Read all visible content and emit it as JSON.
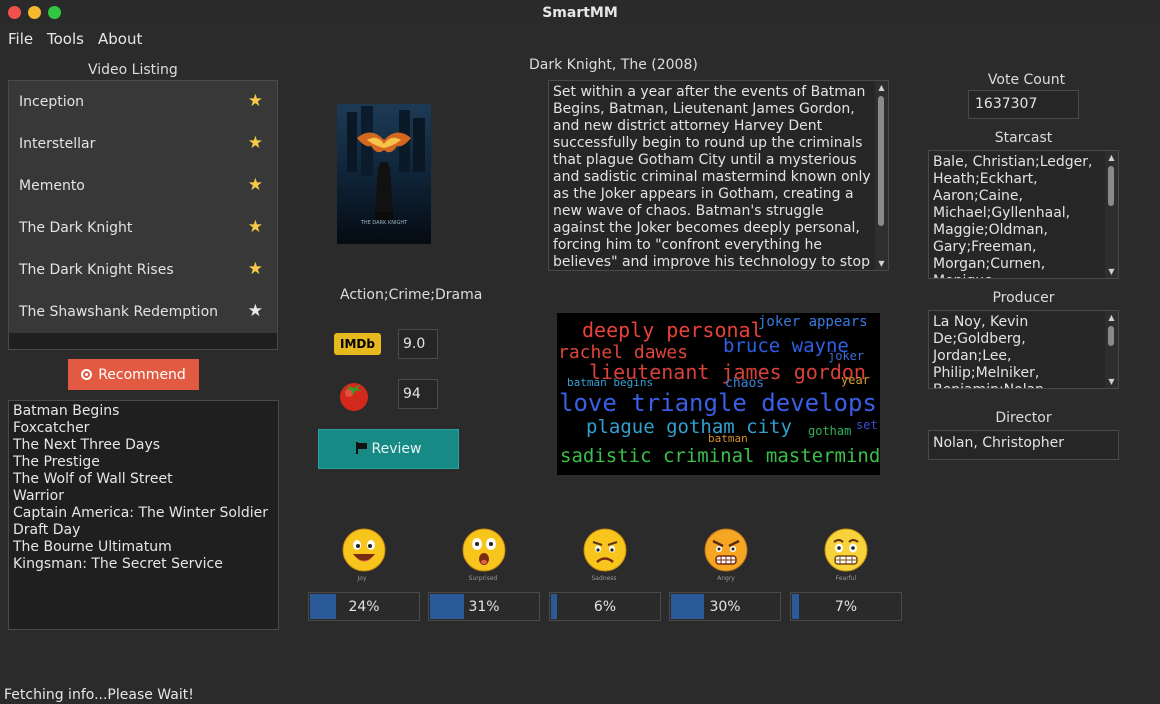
{
  "window": {
    "title": "SmartMM"
  },
  "menu": [
    "File",
    "Tools",
    "About"
  ],
  "listing": {
    "heading": "Video Listing",
    "items": [
      {
        "name": "Inception",
        "star": "gold"
      },
      {
        "name": "Interstellar",
        "star": "gold"
      },
      {
        "name": "Memento",
        "star": "gold"
      },
      {
        "name": "The Dark Knight",
        "star": "gold"
      },
      {
        "name": "The Dark Knight Rises",
        "star": "gold"
      },
      {
        "name": "The Shawshank Redemption",
        "star": "white"
      }
    ]
  },
  "recommend": {
    "button_label": "Recommend",
    "items": [
      "Batman Begins",
      "Foxcatcher",
      "The Next Three Days",
      "The Prestige",
      "The Wolf of Wall Street",
      "Warrior",
      "Captain America: The Winter Soldier",
      "Draft Day",
      "The Bourne Ultimatum",
      "Kingsman: The Secret Service"
    ]
  },
  "movie": {
    "title": "Dark Knight, The (2008)",
    "synopsis": "Set within a year after the events of Batman Begins, Batman, Lieutenant James Gordon, and new district attorney Harvey Dent successfully begin to round up the criminals that plague Gotham City until a mysterious and sadistic criminal mastermind known only as the Joker appears in Gotham, creating a new wave of chaos. Batman's struggle against the Joker becomes deeply personal, forcing him to \"confront everything he believes\" and improve his technology to stop him. A love triangle develops between Bruce Wayne, Dent and Rachel Dawes.",
    "genre": "Action;Crime;Drama",
    "imdb_logo": "IMDb",
    "imdb_rating": "9.0",
    "rt_score": "94",
    "review_label": "Review",
    "poster_caption": "THE DARK KNIGHT"
  },
  "info": {
    "vote_count_label": "Vote Count",
    "vote_count": "1637307",
    "starcast_label": "Starcast",
    "starcast": "Bale, Christian;Ledger, Heath;Eckhart, Aaron;Caine, Michael;Gyllenhaal, Maggie;Oldman, Gary;Freeman, Morgan;Curnen, Monique Gabriela;Ramirez, Ron",
    "producer_label": "Producer",
    "producer": "La Noy, Kevin De;Goldberg, Jordan;Lee, Philip;Melniker, Benjamin;Nolan, Christopher",
    "director_label": "Director",
    "director": "Nolan, Christopher"
  },
  "wordcloud": [
    {
      "text": "deeply personal",
      "color": "#e8403a"
    },
    {
      "text": "joker appears",
      "color": "#3a7be0"
    },
    {
      "text": "rachel dawes",
      "color": "#e0453a"
    },
    {
      "text": "bruce wayne",
      "color": "#2f5fe6"
    },
    {
      "text": "joker",
      "color": "#3a6fd6"
    },
    {
      "text": "lieutenant james gordon",
      "color": "#d8403a"
    },
    {
      "text": "batman begins",
      "color": "#32a0d8"
    },
    {
      "text": "chaos",
      "color": "#3a82d8"
    },
    {
      "text": "year",
      "color": "#d8a02a"
    },
    {
      "text": "love triangle develops",
      "color": "#3a5fe6"
    },
    {
      "text": "plague gotham city",
      "color": "#30a0d0"
    },
    {
      "text": "gotham",
      "color": "#2eb05a"
    },
    {
      "text": "set",
      "color": "#3a4fd6"
    },
    {
      "text": "batman",
      "color": "#d8902a"
    },
    {
      "text": "sadistic criminal mastermind",
      "color": "#3cbf4a"
    }
  ],
  "emotions": [
    {
      "label": "Joy",
      "value": 24,
      "display": "24%",
      "face": "joy"
    },
    {
      "label": "Surprised",
      "value": 31,
      "display": "31%",
      "face": "surprised"
    },
    {
      "label": "Sadness",
      "value": 6,
      "display": "6%",
      "face": "sad"
    },
    {
      "label": "Angry",
      "value": 30,
      "display": "30%",
      "face": "angry"
    },
    {
      "label": "Fearful",
      "value": 7,
      "display": "7%",
      "face": "fearful"
    }
  ],
  "status": "Fetching info...Please Wait!"
}
